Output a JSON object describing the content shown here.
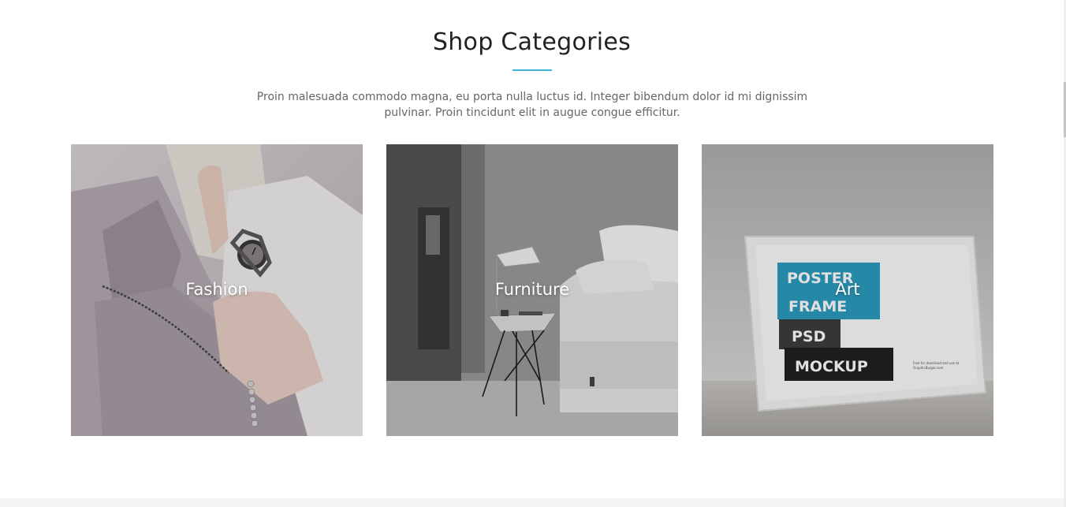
{
  "section": {
    "title": "Shop Categories",
    "intro": "Proin malesuada commodo magna, eu porta nulla luctus id. Integer bibendum dolor id mi dignissim pulvinar. Proin tincidunt elit in augue congue efficitur.",
    "accent_color": "#3fb3d4"
  },
  "categories": [
    {
      "label": "Fashion",
      "image": "fashion-photo"
    },
    {
      "label": "Furniture",
      "image": "furniture-photo"
    },
    {
      "label": "Art",
      "image": "poster-frame-photo",
      "poster": {
        "line1": "POSTER",
        "line2": "FRAME",
        "line3": "PSD",
        "line4": "MOCKUP",
        "fine_print_1": "Free for download and use at",
        "fine_print_2": "GraphicBurger.com"
      }
    }
  ]
}
